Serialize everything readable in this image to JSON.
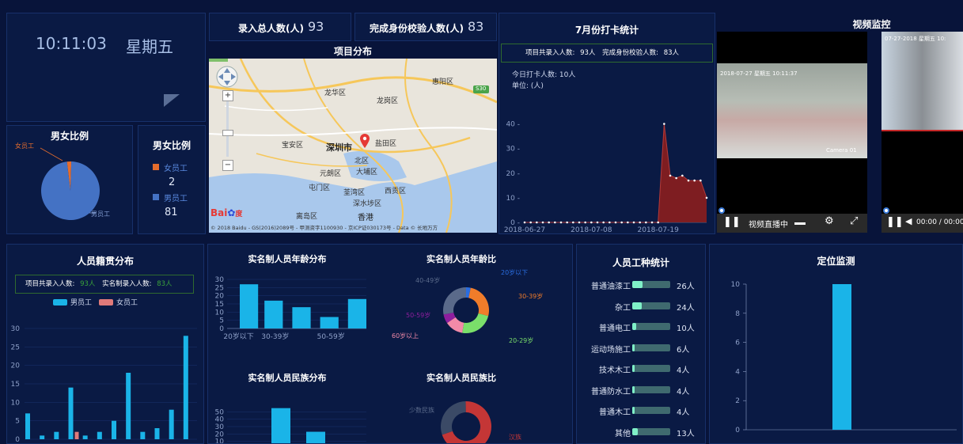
{
  "clock": {
    "time": "10:11:03",
    "weekday": "星期五"
  },
  "stats": {
    "total_label": "录入总人数(人)",
    "total_value": "93",
    "verified_label": "完成身份校验人数(人)",
    "verified_value": "83"
  },
  "gender_pie": {
    "title": "男女比例",
    "female_label": "女员工",
    "male_label": "男员工"
  },
  "gender_legend": {
    "title": "男女比例",
    "female_label": "女员工",
    "female_value": "2",
    "male_label": "男员工",
    "male_value": "81"
  },
  "map": {
    "title": "项目分布",
    "districts": [
      "龙华区",
      "龙岗区",
      "惠阳区",
      "宝安区",
      "深圳市",
      "盐田区",
      "北区",
      "元朗区",
      "大埔区",
      "屯门区",
      "荃湾区",
      "西贡区",
      "深水埗区",
      "离岛区",
      "香港"
    ],
    "logo_text": "Bai",
    "logo_tail": "度",
    "road_badge": "S30",
    "copyright": "© 2018 Baidu - GS(2016)2089号 - 甲测资字1100930 - 京ICP证030173号 - Data © 长地万方"
  },
  "july_checkin": {
    "title": "7月份打卡统计",
    "summary_total_label": "项目共录入人数:",
    "summary_total_value": "93人",
    "summary_verified_label": "完成身份校验人数:",
    "summary_verified_value": "83人",
    "today_label": "今日打卡人数: 10人",
    "unit_label": "单位: (人)"
  },
  "video": {
    "title": "视频监控",
    "cam1_timestamp": "2018-07-27 星期五 10:11:37",
    "cam1_label": "Camera 01",
    "cam2_timestamp": "07-27-2018 星期五 10:",
    "live_text": "视频直播中",
    "time_text": "00:00 / 00:00"
  },
  "origin": {
    "title": "人员籍贯分布",
    "summary_total_label": "项目共录入人数:",
    "summary_total_value": "93人",
    "summary_real_label": "实名制录入人数:",
    "summary_real_value": "83人",
    "legend_male": "男员工",
    "legend_female": "女员工"
  },
  "age_bar_title": "实名制人员年龄分布",
  "age_donut": {
    "title": "实名制人员年龄比",
    "labels": [
      "20岁以下",
      "30-39岁",
      "20-29岁",
      "60岁以上",
      "50-59岁",
      "40-49岁"
    ]
  },
  "ethnic_bar_title": "实名制人员民族分布",
  "ethnic_donut": {
    "title": "实名制人员民族比",
    "labels": [
      "少数民族",
      "汉族"
    ]
  },
  "work_types": {
    "title": "人员工种统计",
    "items": [
      {
        "name": "普通油漆工",
        "count": "26人",
        "fraction": 0.26
      },
      {
        "name": "杂工",
        "count": "24人",
        "fraction": 0.24
      },
      {
        "name": "普通电工",
        "count": "10人",
        "fraction": 0.1
      },
      {
        "name": "运动场施工",
        "count": "6人",
        "fraction": 0.06
      },
      {
        "name": "技术木工",
        "count": "4人",
        "fraction": 0.04
      },
      {
        "name": "普通防水工",
        "count": "4人",
        "fraction": 0.04
      },
      {
        "name": "普通木工",
        "count": "4人",
        "fraction": 0.04
      },
      {
        "name": "其他",
        "count": "13人",
        "fraction": 0.13
      }
    ]
  },
  "location_title": "定位监测",
  "colors": {
    "bg": "#08143a",
    "panel": "#0a1a44",
    "cyan": "#1ab4e8",
    "pink": "#e07a7a",
    "dark_red": "#8b1e1e",
    "green_border": "#2f6a2f",
    "male_blue": "#4472c4",
    "female_orange": "#e46c2d"
  },
  "chart_data": [
    {
      "type": "pie",
      "title": "男女比例",
      "labels": [
        "女员工",
        "男员工"
      ],
      "values": [
        2,
        81
      ]
    },
    {
      "type": "area",
      "title": "7月份打卡统计",
      "x": [
        "2018-06-27",
        "2018-06-28",
        "2018-06-29",
        "2018-06-30",
        "2018-07-01",
        "2018-07-02",
        "2018-07-03",
        "2018-07-04",
        "2018-07-05",
        "2018-07-06",
        "2018-07-07",
        "2018-07-08",
        "2018-07-09",
        "2018-07-10",
        "2018-07-11",
        "2018-07-12",
        "2018-07-13",
        "2018-07-14",
        "2018-07-15",
        "2018-07-16",
        "2018-07-17",
        "2018-07-18",
        "2018-07-19",
        "2018-07-20",
        "2018-07-21",
        "2018-07-22",
        "2018-07-23",
        "2018-07-24",
        "2018-07-25",
        "2018-07-26",
        "2018-07-27"
      ],
      "values": [
        0,
        0,
        0,
        0,
        0,
        0,
        0,
        0,
        0,
        0,
        0,
        0,
        0,
        0,
        0,
        0,
        0,
        0,
        0,
        0,
        0,
        0,
        0,
        40,
        19,
        18,
        19,
        17,
        17,
        17,
        10
      ],
      "xticks": [
        "2018-06-27",
        "2018-07-08",
        "2018-07-19"
      ],
      "yticks": [
        0,
        10,
        20,
        30,
        40
      ],
      "ylim": [
        0,
        45
      ]
    },
    {
      "type": "bar",
      "title": "人员籍贯分布",
      "ylim": [
        0,
        30
      ],
      "yticks": [
        0,
        5,
        10,
        15,
        20,
        25,
        30
      ],
      "series": [
        {
          "name": "男员工",
          "values": [
            7,
            1,
            2,
            14,
            1,
            2,
            5,
            18,
            2,
            3,
            8,
            28
          ]
        },
        {
          "name": "女员工",
          "values": [
            0,
            0,
            0,
            2,
            0,
            0,
            0,
            0,
            0,
            0,
            0,
            0
          ]
        }
      ]
    },
    {
      "type": "bar",
      "title": "实名制人员年龄分布",
      "categories": [
        "20岁以下",
        "30-39岁",
        "40-49岁",
        "50-59岁",
        "60岁以上"
      ],
      "xticks": [
        "20岁以下",
        "30-39岁",
        "50-59岁"
      ],
      "values": [
        27,
        17,
        13,
        7,
        18
      ],
      "yticks": [
        0,
        5,
        10,
        15,
        20,
        25,
        30
      ],
      "ylim": [
        0,
        30
      ]
    },
    {
      "type": "pie",
      "title": "实名制人员年龄比",
      "labels": [
        "20岁以下",
        "30-39岁",
        "20-29岁",
        "60岁以上",
        "50-59岁",
        "40-49岁"
      ],
      "values": [
        3,
        24,
        22,
        12,
        6,
        26
      ],
      "colors": [
        "#2a6de0",
        "#f07c2a",
        "#7adf6a",
        "#f28aa8",
        "#8e1e9e",
        "#5a6a8a"
      ]
    },
    {
      "type": "bar",
      "title": "实名制人员民族分布",
      "values": [
        0,
        55,
        23,
        2
      ],
      "yticks": [
        0,
        10,
        20,
        30,
        40,
        50
      ],
      "ylim": [
        0,
        60
      ]
    },
    {
      "type": "pie",
      "title": "实名制人员民族比",
      "labels": [
        "少数民族",
        "汉族"
      ],
      "values": [
        30,
        70
      ],
      "colors": [
        "#3b4a66",
        "#c43636"
      ]
    },
    {
      "type": "bar",
      "title": "定位监测",
      "values": [
        10
      ],
      "yticks": [
        0,
        2,
        4,
        6,
        8,
        10
      ],
      "ylim": [
        0,
        10
      ]
    }
  ]
}
